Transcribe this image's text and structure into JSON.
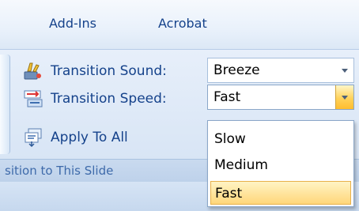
{
  "tabs": [
    "Add-Ins",
    "Acrobat"
  ],
  "ribbon": {
    "transition_sound": {
      "label": "Transition Sound:",
      "value": "Breeze",
      "icon": "transition-sound-icon"
    },
    "transition_speed": {
      "label": "Transition Speed:",
      "value": "Fast",
      "icon": "transition-speed-icon"
    },
    "apply_to_all": {
      "label": "Apply To All",
      "icon": "apply-to-all-icon"
    },
    "group_label": "sition to This Slide"
  },
  "speed_dropdown": {
    "options": [
      "Slow",
      "Medium",
      "Fast"
    ],
    "selected": "Fast"
  },
  "colors": {
    "label_text": "#15428b",
    "hover": "#ffd67a",
    "ribbon_bg": "#dfeaf6"
  }
}
